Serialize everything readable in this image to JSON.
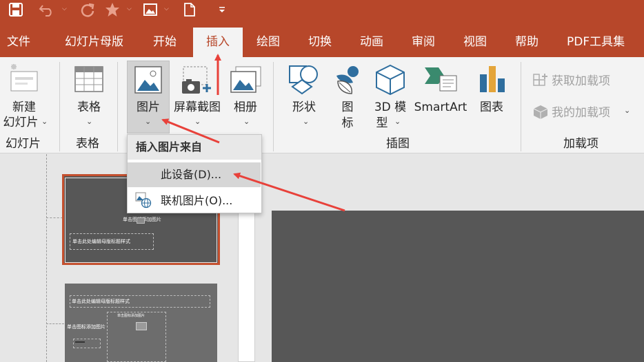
{
  "quick_access": {
    "icons": [
      "save-icon",
      "undo-icon",
      "redo-icon",
      "star-icon",
      "picture-icon",
      "new-file-icon",
      "customize-icon"
    ]
  },
  "tabs": [
    {
      "label": "文件"
    },
    {
      "label": "幻灯片母版"
    },
    {
      "label": "开始"
    },
    {
      "label": "插入"
    },
    {
      "label": "绘图"
    },
    {
      "label": "切换"
    },
    {
      "label": "动画"
    },
    {
      "label": "审阅"
    },
    {
      "label": "视图"
    },
    {
      "label": "帮助"
    },
    {
      "label": "PDF工具集"
    }
  ],
  "active_tab": "插入",
  "ribbon": {
    "new_slide_line1": "新建",
    "new_slide_line2": "幻灯片",
    "table": "表格",
    "pictures": "图片",
    "screenshot": "屏幕截图",
    "album": "相册",
    "shapes": "形状",
    "icons_line1": "图",
    "icons_line2": "标",
    "model3d_line1": "3D 模",
    "model3d_line2": "型",
    "smartart": "SmartArt",
    "chart": "图表",
    "get_addins": "获取加载项",
    "my_addins": "我的加载项",
    "groups": {
      "slides": "幻灯片",
      "tables": "表格",
      "images": "插图",
      "addins": "加载项"
    }
  },
  "dropdown": {
    "header": "插入图片来自",
    "items": [
      {
        "label": "此设备(D)..."
      },
      {
        "label": "联机图片(O)..."
      }
    ]
  },
  "slides": {
    "thumb1_title": "单击图标添加图片",
    "thumb1_body": "单击此处编辑母版标题样式",
    "thumb2_title": "单击此处编辑母版标题样式",
    "thumb2_left": "单击图标添加图片",
    "thumb2_mid": "单击图标添加图片"
  },
  "colors": {
    "accent": "#b7472a",
    "ribbon": "#f3f3f3",
    "arrow": "#e8413a"
  }
}
